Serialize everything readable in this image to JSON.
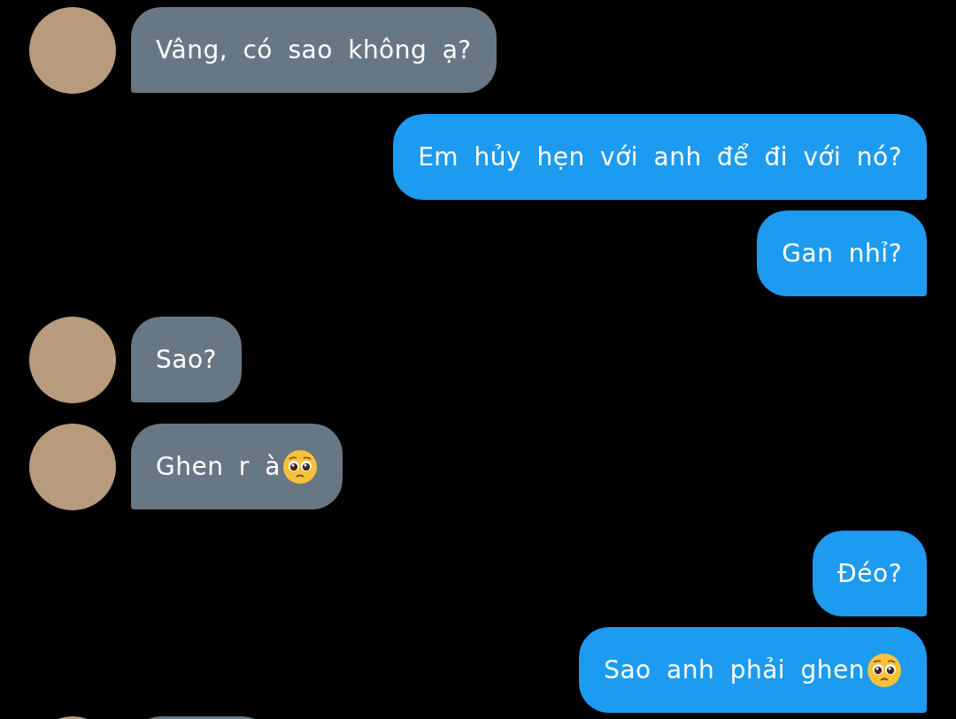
{
  "messages": [
    {
      "kind": "incoming",
      "text": "Vâng, có sao không ạ?"
    },
    {
      "kind": "outgoing",
      "text": "Em hủy hẹn với anh để đi với nó?"
    },
    {
      "kind": "outgoing",
      "text": "Gan nhỉ?"
    },
    {
      "kind": "incoming",
      "text": "Sao?"
    },
    {
      "kind": "incoming",
      "text": "Ghen r à",
      "trailing_icon": true
    },
    {
      "kind": "outgoing",
      "text": "Đéo?"
    },
    {
      "kind": "outgoing",
      "text": "Sao anh phải ghen",
      "trailing_icon": true
    },
    {
      "kind": "incoming"
    }
  ]
}
